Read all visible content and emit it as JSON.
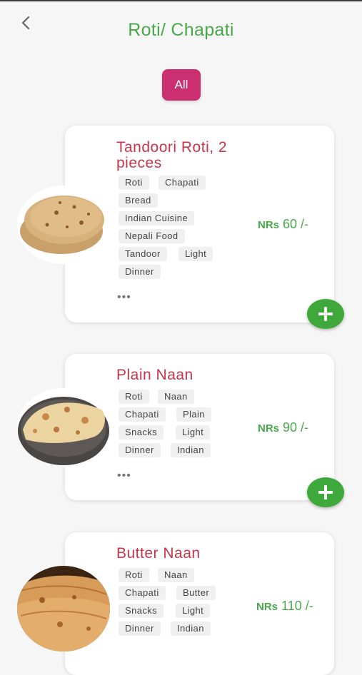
{
  "header": {
    "title": "Roti/ Chapati",
    "back_icon": "chevron-left-icon"
  },
  "filters": [
    {
      "label": "All",
      "active": true
    }
  ],
  "colors": {
    "accent_green": "#48a84a",
    "filter_pink": "#cc2f70",
    "name_red": "#c8354a"
  },
  "items": [
    {
      "name": "Tandoori Roti, 2 pieces",
      "tags": [
        "Roti",
        "Chapati",
        "Bread",
        "Indian Cuisine",
        "Nepali Food",
        "Tandoor",
        "Light",
        "Dinner"
      ],
      "price_currency": "NRs",
      "price_value": "60 /-",
      "more": "•••"
    },
    {
      "name": "Plain Naan",
      "tags": [
        "Roti",
        "Naan",
        "Chapati",
        "Plain",
        "Snacks",
        "Light",
        "Dinner",
        "Indian"
      ],
      "price_currency": "NRs",
      "price_value": "90 /-",
      "more": "•••"
    },
    {
      "name": "Butter Naan",
      "tags": [
        "Roti",
        "Naan",
        "Chapati",
        "Butter",
        "Snacks",
        "Light",
        "Dinner",
        "Indian"
      ],
      "price_currency": "NRs",
      "price_value": "110 /-"
    }
  ]
}
